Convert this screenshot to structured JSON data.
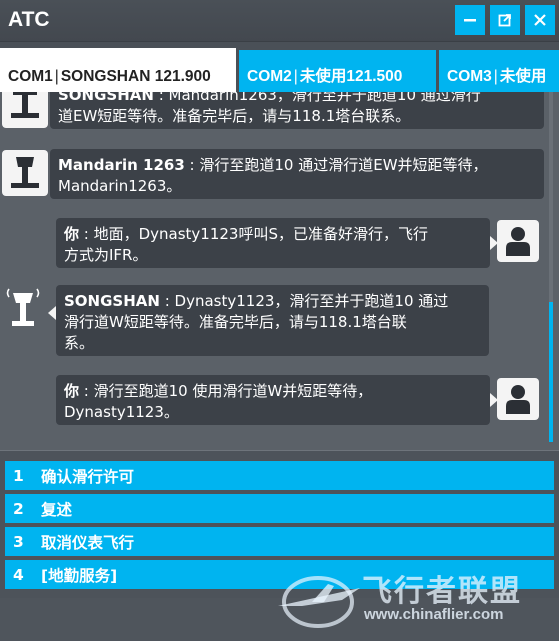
{
  "window": {
    "title": "ATC",
    "minimize_icon": "minimize-icon",
    "restore_icon": "popout-icon",
    "close_icon": "close-icon"
  },
  "tabs": [
    {
      "name": "COM1",
      "station": "SONGSHAN",
      "freq": "121.900",
      "active": true
    },
    {
      "name": "COM2",
      "station": "未使用",
      "freq": "121.500",
      "active": false
    },
    {
      "name": "COM3",
      "station": "未使用",
      "freq": "",
      "active": false
    }
  ],
  "messages": [
    {
      "speaker": "SONGSHAN",
      "text": "Mandarin1263，滑行至并于跑道10 通过滑行道EW短距等待。准备完毕后，请与118.1塔台联系。",
      "line2": "道EW短距等待。准备完毕后，请与118.1塔台联系。",
      "line1_partial": "SONGSHAN : Mandarin1263，滑行至并于跑道10 通过滑行",
      "side": "atc"
    },
    {
      "speaker": "Mandarin 1263",
      "text": " : 滑行至跑道10 通过滑行道EW并短距等待，",
      "text2": "Mandarin1263。",
      "side": "atc"
    },
    {
      "speaker": "你",
      "text": " : 地面，Dynasty1123呼叫S，已准备好滑行，飞行",
      "text2": "方式为IFR。",
      "side": "user"
    },
    {
      "speaker": "SONGSHAN",
      "text": " : Dynasty1123，滑行至并于跑道10 通过",
      "text2": "滑行道W短距等待。准备完毕后，请与118.1塔台联",
      "text3": "系。",
      "side": "atc"
    },
    {
      "speaker": "你",
      "text": " : 滑行至跑道10 使用滑行道W并短距等待，",
      "text2": "Dynasty1123。",
      "side": "user"
    }
  ],
  "options": [
    {
      "num": "1",
      "label": "确认滑行许可"
    },
    {
      "num": "2",
      "label": "复述"
    },
    {
      "num": "3",
      "label": "取消仪表飞行"
    },
    {
      "num": "4",
      "label": "[地勤服务]"
    }
  ],
  "watermark": {
    "text": "飞行者联盟",
    "url": "www.chinaflier.com"
  },
  "colors": {
    "accent": "#00b4f0",
    "bubble": "#3c4148",
    "background": "#5b6168"
  }
}
